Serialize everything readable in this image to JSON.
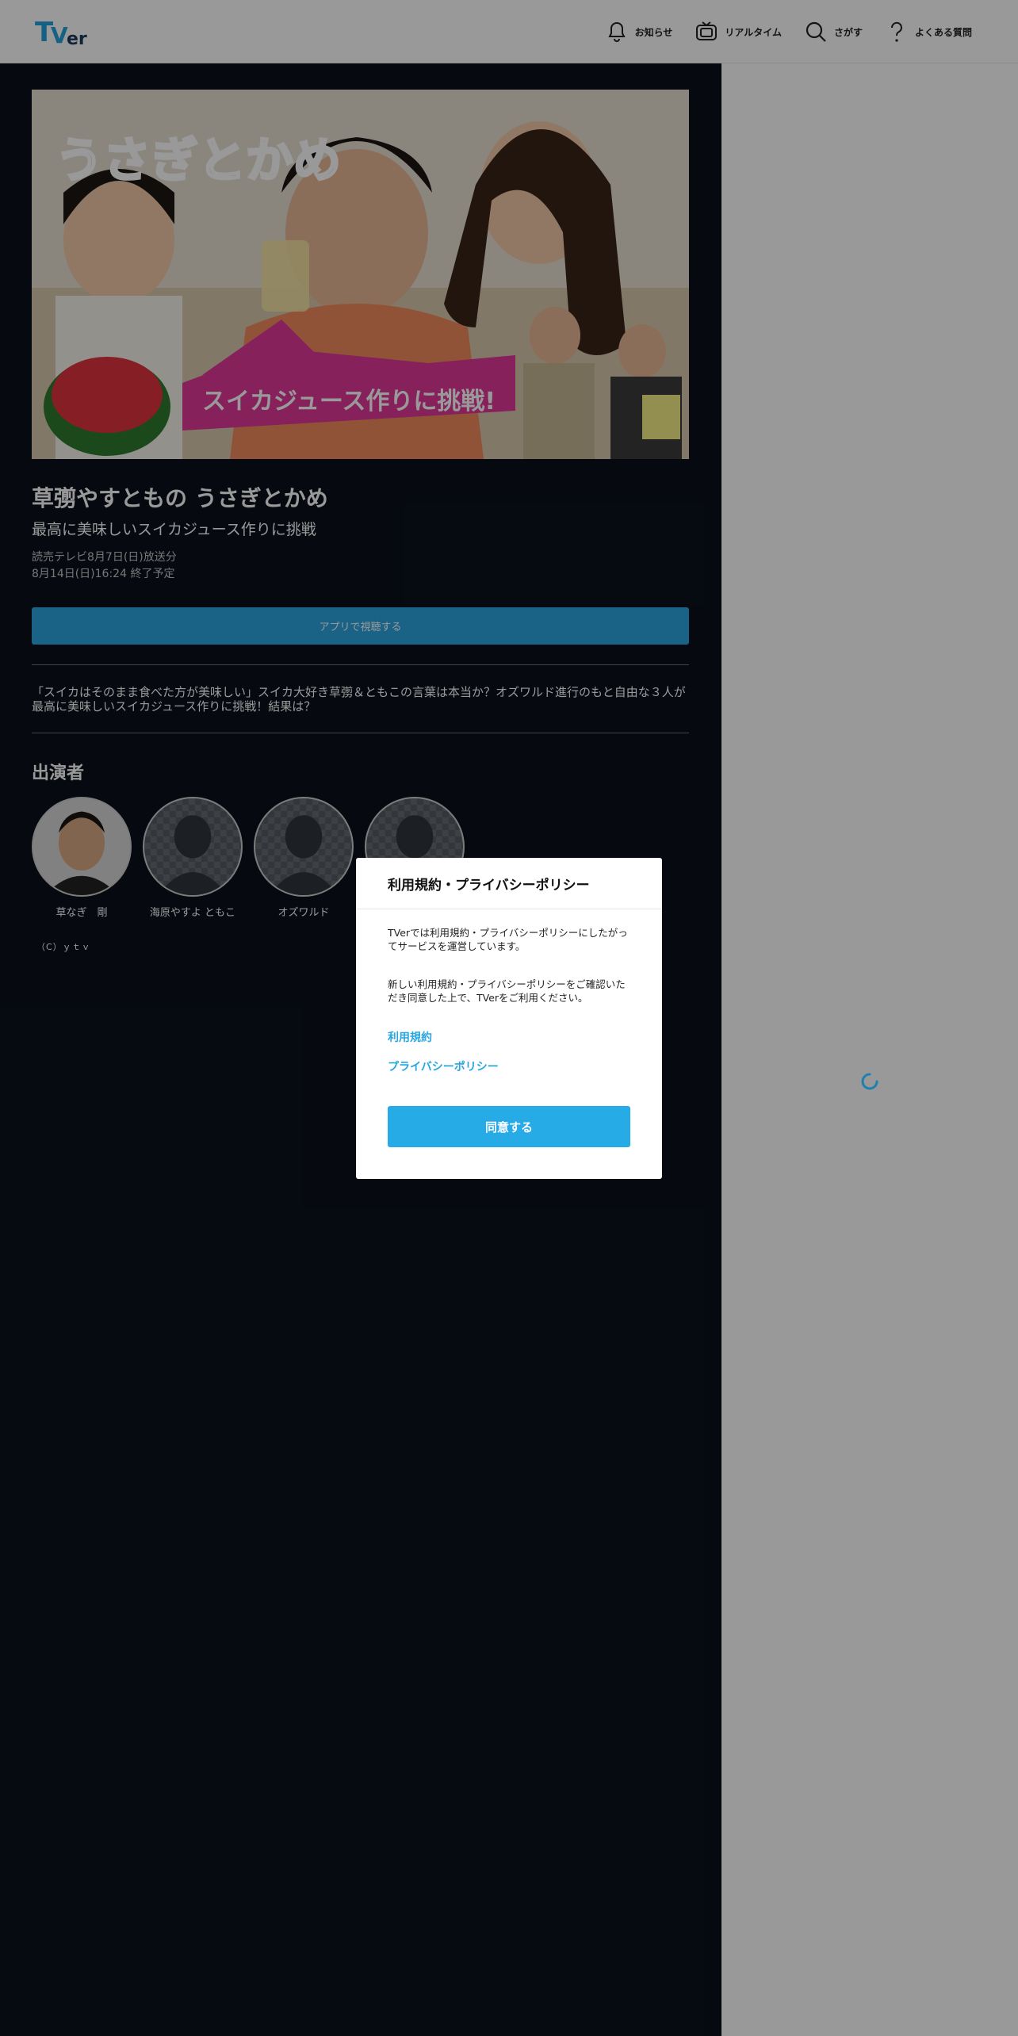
{
  "header": {
    "logo_text": "TVer",
    "nav": [
      {
        "label": "お知らせ",
        "icon": "bell-icon"
      },
      {
        "label": "リアルタイム",
        "icon": "tv-icon"
      },
      {
        "label": "さがす",
        "icon": "search-icon"
      },
      {
        "label": "よくある質問",
        "icon": "question-icon"
      }
    ]
  },
  "episode": {
    "title": "草彅やすともの うさぎとかめ",
    "subtitle": "最高に美味しいスイカジュース作りに挑戦",
    "broadcast": "読売テレビ8月7日(日)放送分",
    "expiry": "8月14日(日)16:24 終了予定",
    "app_button": "アプリで視聴する",
    "description": "「スイカはそのまま食べた方が美味しい」スイカ大好き草彅＆ともこの言葉は本当か？オズワルド進行のもと自由な３人が最高に美味しいスイカジュース作りに挑戦！結果は？",
    "thumbnail_logo": "うさぎとかめ",
    "thumbnail_caption": "スイカジュース作りに挑戦!"
  },
  "cast": {
    "heading": "出演者",
    "members": [
      {
        "name": "草なぎ　剛"
      },
      {
        "name": "海原やすよ ともこ"
      },
      {
        "name": "オズワルド"
      },
      {
        "name": ""
      }
    ]
  },
  "copyright": "（C）ｙｔｖ",
  "modal": {
    "title": "利用規約・プライバシーポリシー",
    "p1": "TVerでは利用規約・プライバシーポリシーにしたがってサービスを運営しています。",
    "p2": "新しい利用規約・プライバシーポリシーをご確認いただき同意した上で、TVerをご利用ください。",
    "link_terms": "利用規約",
    "link_privacy": "プライバシーポリシー",
    "agree_button": "同意する"
  },
  "colors": {
    "accent": "#27abe6",
    "dark_bg": "#0a111c"
  }
}
